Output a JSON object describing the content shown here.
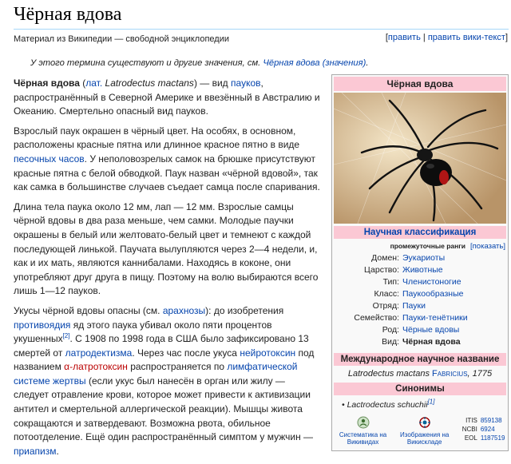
{
  "page": {
    "title": "Чёрная вдова",
    "source": "Материал из Википедии — свободной энциклопедии",
    "edit": "править",
    "edit_source": "править вики-текст",
    "hatnote_text": "У этого термина существуют и другие значения, см.",
    "hatnote_link": "Чёрная вдова (значения)"
  },
  "article": {
    "p1": {
      "bold": "Чёрная вдова",
      "lat_prefix": "лат.",
      "lat_name": "Latrodectus mactans",
      "t1": " — вид ",
      "l_spiders": "пауков",
      "t2": ", распространённый в Северной Америке и ввезённый в Австралию и Океанию. Смертельно опасный вид пауков."
    },
    "p2": {
      "t1": "Взрослый паук окрашен в чёрный цвет. На особях, в основном, расположены красные пятна или длинное красное пятно в виде ",
      "l_hourglass": "песочных часов",
      "t2": ". У неполовозрелых самок на брюшке присутствуют красные пятна с белой обводкой. Паук назван «чёрной вдовой», так как самка в большинстве случаев съедает самца после спаривания."
    },
    "p3": {
      "t1": "Длина тела паука около 12 мм, лап — 12 мм. Взрослые самцы чёрной вдовы в два раза меньше, чем самки. Молодые паучки окрашены в белый или желтовато-белый цвет и темнеют с каждой последующей линькой. Паучата вылупляются через 2—4 недели, и, как и их мать, являются каннибалами. Находясь в коконе, они употребляют друг друга в пищу. Поэтому на волю выбираются всего лишь 1—12 пауков."
    },
    "p4": {
      "t1": "Укусы чёрной вдовы опасны (см. ",
      "l_arachnoses": "арахнозы",
      "t2": "): до изобретения ",
      "l_antidote": "противоядия",
      "t3": " яд этого паука убивал около пяти процентов укушенных",
      "ref2": "[2]",
      "t4": ". С 1908 по 1998 года в США было зафиксировано 13 смертей от ",
      "l_latrodectism": "латродектизма",
      "t5": ". Через час после укуса ",
      "l_neurotoxin": "нейротоксин",
      "t6": " под названием ",
      "l_alpha": "α-латротоксин",
      "t7": " распространяется по ",
      "l_lymph": "лимфатической системе жертвы",
      "t8": " (если укус был нанесён в орган или жилу — следует отравление крови, которое может привести к активизации антител и смертельной аллергической реакции). Мышцы живота сокращаются и затвердевают. Возможна рвота, обильное потоотделение. Ещё один распространённый симптом у мужчин — ",
      "l_priapism": "приапизм",
      "t9": "."
    }
  },
  "infobox": {
    "title": "Чёрная вдова",
    "sci_class": "Научная классификация",
    "intermediate_ranks": "промежуточные ранги",
    "show": "[показать]",
    "taxonomy": [
      {
        "rank": "Домен:",
        "value": "Эукариоты",
        "link": true
      },
      {
        "rank": "Царство:",
        "value": "Животные",
        "link": true
      },
      {
        "rank": "Тип:",
        "value": "Членистоногие",
        "link": true
      },
      {
        "rank": "Класс:",
        "value": "Паукообразные",
        "link": true
      },
      {
        "rank": "Отряд:",
        "value": "Пауки",
        "link": true
      },
      {
        "rank": "Семейство:",
        "value": "Пауки-тенётники",
        "link": true
      },
      {
        "rank": "Род:",
        "value": "Чёрные вдовы",
        "link": true
      },
      {
        "rank": "Вид:",
        "value": "Чёрная вдова",
        "link": false
      }
    ],
    "intl_name_header": "Международное научное название",
    "intl_name": "Latrodectus mactans",
    "intl_author": "Fabricius",
    "intl_year": ", 1775",
    "synonyms_header": "Синонимы",
    "synonym": "Lactrodectus schuchii",
    "synonym_ref": "[1]",
    "footer": {
      "systematics": "Систематика на Викивидах",
      "images": "Изображения на Викискладе",
      "ids": [
        {
          "key": "ITIS",
          "value": "859138"
        },
        {
          "key": "NCBI",
          "value": "6924"
        },
        {
          "key": "EOL",
          "value": "1187519"
        }
      ]
    }
  }
}
